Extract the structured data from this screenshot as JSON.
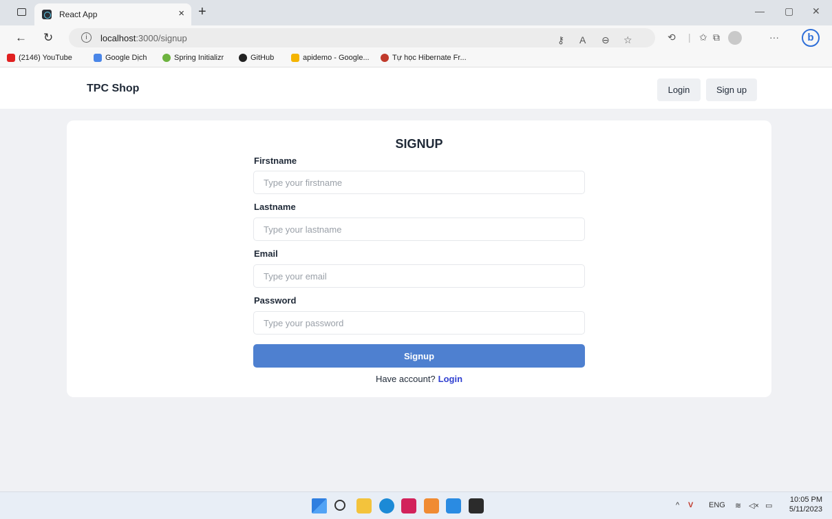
{
  "browser": {
    "tab_title": "React App",
    "tab_close": "×",
    "new_tab": "+",
    "url_host": "localhost",
    "url_path": ":3000/signup",
    "bookmarks": [
      {
        "label": "(2146) YouTube",
        "color": "#e02020"
      },
      {
        "label": "Google Dịch",
        "color": "#4a86e8"
      },
      {
        "label": "Spring Initializr",
        "color": "#6db33f"
      },
      {
        "label": "GitHub",
        "color": "#222222"
      },
      {
        "label": "apidemo - Google...",
        "color": "#f4b400"
      },
      {
        "label": "Tự học Hibernate Fr...",
        "color": "#c0392b"
      }
    ]
  },
  "header": {
    "brand": "TPC Shop",
    "login_label": "Login",
    "signup_label": "Sign up"
  },
  "form": {
    "title": "SIGNUP",
    "fields": [
      {
        "label": "Firstname",
        "placeholder": "Type your firstname"
      },
      {
        "label": "Lastname",
        "placeholder": "Type your lastname"
      },
      {
        "label": "Email",
        "placeholder": "Type your email"
      },
      {
        "label": "Password",
        "placeholder": "Type your password"
      }
    ],
    "submit_label": "Signup",
    "have_account_text": "Have account?",
    "login_link": "Login"
  },
  "taskbar": {
    "language": "ENG",
    "time": "10:05 PM",
    "date": "5/11/2023"
  },
  "colors": {
    "accent": "#4e80d0",
    "link": "#2f3fd0",
    "page_bg": "#f0f1f4"
  }
}
